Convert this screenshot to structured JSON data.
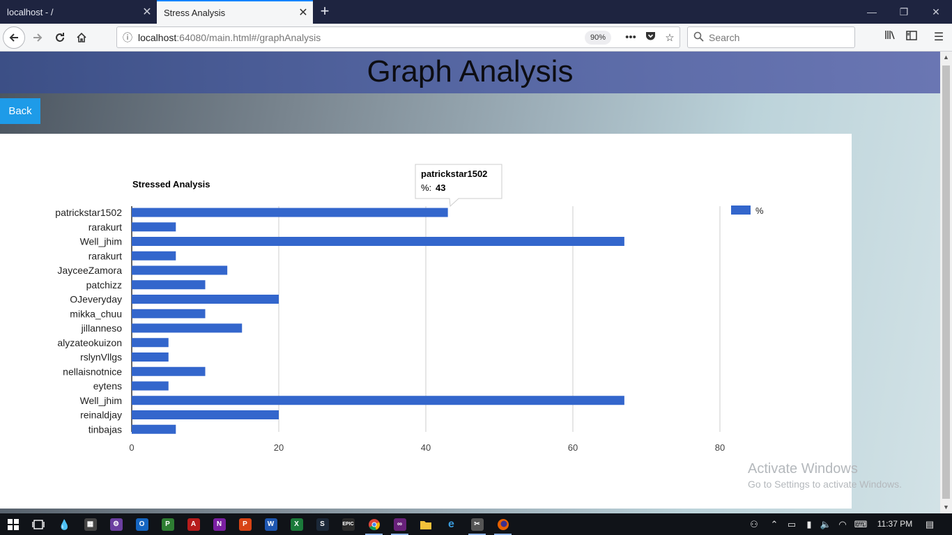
{
  "browser": {
    "tabs": [
      {
        "title": "localhost - /",
        "active": false
      },
      {
        "title": "Stress Analysis",
        "active": true
      }
    ],
    "new_tab": "+",
    "url_host": "localhost",
    "url_rest": ":64080/main.html#/graphAnalysis",
    "zoom": "90%",
    "search_placeholder": "Search"
  },
  "page": {
    "title": "Graph Analysis",
    "back_label": "Back"
  },
  "chart_data": {
    "type": "bar",
    "orientation": "horizontal",
    "title": "Stressed Analysis",
    "categories": [
      "patrickstar1502",
      "rarakurt",
      "Well_jhim",
      "rarakurt",
      "JayceeZamora",
      "patchizz",
      "OJeveryday",
      "mikka_chuu",
      "jillanneso",
      "alyzateokuizon",
      "rslynVllgs",
      "nellaisnotnice",
      "eytens",
      "Well_jhim",
      "reinaldjay",
      "tinbajas"
    ],
    "series": [
      {
        "name": "%",
        "color": "#3366cc",
        "values": [
          43,
          6,
          67,
          6,
          13,
          10,
          20,
          10,
          15,
          5,
          5,
          10,
          5,
          67,
          20,
          6
        ]
      }
    ],
    "xlim": [
      0,
      80
    ],
    "xticks": [
      "0",
      "20",
      "40",
      "60",
      "80"
    ],
    "grid": true,
    "legend": "right",
    "tooltip": {
      "category": "patrickstar1502",
      "label": "%:",
      "value": "43"
    }
  },
  "watermark": {
    "title": "Activate Windows",
    "subtitle": "Go to Settings to activate Windows."
  },
  "taskbar": {
    "time": "11:37 PM",
    "apps": [
      "chrome-icon",
      "visual-studio-icon",
      "file-explorer-icon",
      "edge-icon",
      "snipping-tool-icon",
      "firefox-icon"
    ]
  },
  "colors": {
    "bar": "#3366cc",
    "header": "#5667a3",
    "back_button": "#1e9be8"
  }
}
